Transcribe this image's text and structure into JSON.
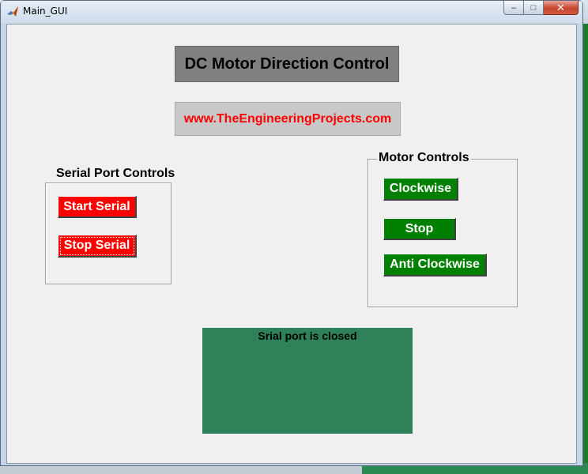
{
  "window": {
    "title": "Main_GUI",
    "buttons": {
      "minimize": "‒",
      "maximize": "□",
      "close": "✕"
    }
  },
  "header": {
    "title": "DC Motor Direction Control",
    "url": "www.TheEngineeringProjects.com"
  },
  "serial_panel": {
    "title": "Serial Port Controls",
    "start_label": "Start Serial",
    "stop_label": "Stop Serial"
  },
  "motor_panel": {
    "title": "Motor Controls",
    "clockwise_label": "Clockwise",
    "stop_label": "Stop",
    "anticlockwise_label": "Anti Clockwise"
  },
  "status": {
    "text": "Srial port is closed"
  },
  "colors": {
    "red_button": "#ff0000",
    "green_button": "#008000",
    "status_panel": "#2e8159",
    "url_text": "#ff0000",
    "title_panel": "#808080"
  },
  "icons": {
    "app": "matlab-icon"
  }
}
